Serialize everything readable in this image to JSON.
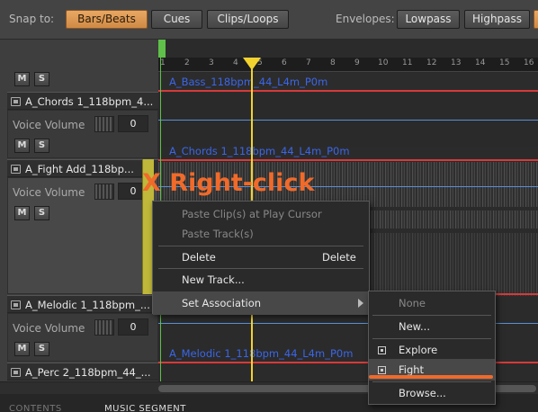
{
  "toolbar": {
    "snap_label": "Snap to:",
    "snap_options": [
      "Bars/Beats",
      "Cues",
      "Clips/Loops"
    ],
    "envelopes_label": "Envelopes:",
    "envelope_options": [
      "Lowpass",
      "Highpass"
    ]
  },
  "ruler": [
    "1",
    "2",
    "3",
    "4",
    "5",
    "6",
    "7",
    "8",
    "9",
    "10",
    "11",
    "12",
    "13",
    "14",
    "15",
    "16"
  ],
  "tracks": [
    {
      "name": "A_Chords 1_118bpm_4...",
      "volume_label": "Voice Volume",
      "volume_value": "0",
      "mute": "M",
      "solo": "S"
    },
    {
      "name": "A_Fight Add_118bp...",
      "volume_label": "Voice Volume",
      "volume_value": "0",
      "mute": "M",
      "solo": "S"
    },
    {
      "name": "A_Melodic 1_118bpm_...",
      "volume_label": "Voice Volume",
      "volume_value": "0",
      "mute": "M",
      "solo": "S"
    },
    {
      "name": "A_Perc 2_118bpm_44_..."
    }
  ],
  "top_buttons": {
    "mute": "M",
    "solo": "S"
  },
  "clips": [
    "A_Bass_118bpm_44_L4m_P0m",
    "A_Chords 1_118bpm_44_L4m_P0m",
    "A_Melodic 1_118bpm_44_L4m_P0m"
  ],
  "annotation": "X Right-click",
  "context_menu": {
    "paste_clips": "Paste Clip(s) at Play Cursor",
    "paste_tracks": "Paste Track(s)",
    "delete": "Delete",
    "delete_shortcut": "Delete",
    "new_track": "New Track...",
    "set_association": "Set Association"
  },
  "submenu": {
    "none": "None",
    "new": "New...",
    "explore": "Explore",
    "fight": "Fight",
    "browse": "Browse..."
  },
  "bottom_tabs": {
    "contents": "CONTENTS",
    "music_segment": "MUSIC SEGMENT"
  },
  "colors": {
    "accent": "#f06a2a",
    "active_button": "#e8a864",
    "clip_label": "#3b66e8",
    "playhead": "#f2d22e",
    "loop": "#5fc04a"
  }
}
